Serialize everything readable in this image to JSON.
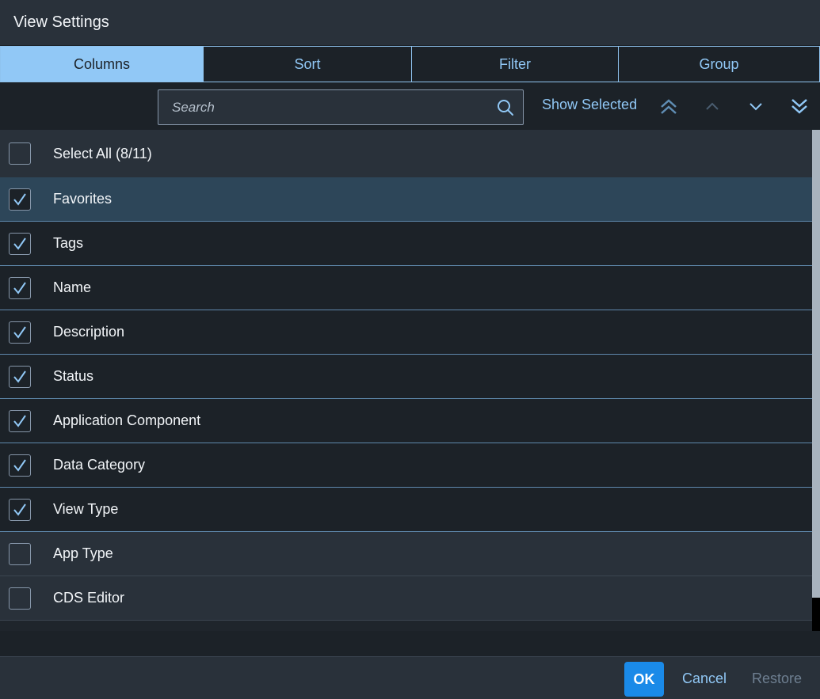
{
  "dialog": {
    "title": "View Settings"
  },
  "tabs": [
    {
      "label": "Columns",
      "active": true
    },
    {
      "label": "Sort",
      "active": false
    },
    {
      "label": "Filter",
      "active": false
    },
    {
      "label": "Group",
      "active": false
    }
  ],
  "toolbar": {
    "search_placeholder": "Search",
    "search_icon": "search-icon",
    "show_selected_label": "Show Selected",
    "move_icons": [
      "double-chevron-up-icon",
      "chevron-up-icon",
      "chevron-down-icon",
      "double-chevron-down-icon"
    ]
  },
  "list": {
    "select_all_label": "Select All (8/11)",
    "select_all_checked": false,
    "items": [
      {
        "label": "Favorites",
        "checked": true
      },
      {
        "label": "Tags",
        "checked": true
      },
      {
        "label": "Name",
        "checked": true
      },
      {
        "label": "Description",
        "checked": true
      },
      {
        "label": "Status",
        "checked": true
      },
      {
        "label": "Application Component",
        "checked": true
      },
      {
        "label": "Data Category",
        "checked": true
      },
      {
        "label": "View Type",
        "checked": true
      },
      {
        "label": "App Type",
        "checked": false
      },
      {
        "label": "CDS Editor",
        "checked": false
      }
    ]
  },
  "footer": {
    "ok_label": "OK",
    "cancel_label": "Cancel",
    "restore_label": "Restore"
  },
  "colors": {
    "accent": "#91c8f6",
    "primary_button": "#1a8ae8",
    "background": "#1c2228",
    "header_background": "#29313a"
  }
}
